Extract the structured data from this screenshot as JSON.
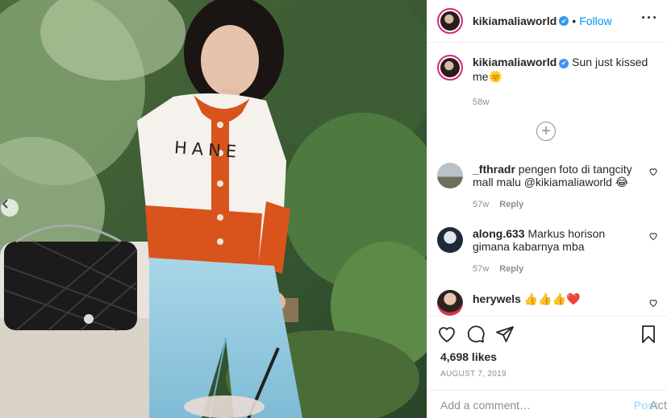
{
  "post": {
    "username": "kikiamaliaworld",
    "verified_mark": "✔",
    "separator": "•",
    "follow_label": "Follow",
    "more_label": "···",
    "caption_text": "Sun just kissed me",
    "caption_emoji": "🌞",
    "caption_time": "58w",
    "load_more_label": "+",
    "photo_sweater_text": "HANE"
  },
  "comments": [
    {
      "username": "_fthradr",
      "text": "pengen foto di tangcity mall malu @kikiamaliaworld 😂",
      "time": "57w",
      "reply_label": "Reply"
    },
    {
      "username": "along.633",
      "text": "Markus horison gimana kabarnya mba",
      "time": "57w",
      "reply_label": "Reply"
    },
    {
      "username": "herywels",
      "text": "👍👍👍❤️",
      "time": "",
      "reply_label": ""
    }
  ],
  "actions": {
    "likes_label": "4,698 likes",
    "date_label": "AUGUST 7, 2019",
    "comment_placeholder": "Add a comment…",
    "post_label": "Post",
    "watermark": "Act"
  },
  "colors": {
    "accent_blue": "#0095f6",
    "verified_blue": "#3897f0",
    "post_disabled": "#b2dffc",
    "muted": "#8e8e8e"
  },
  "icons": [
    "prev-arrow-icon",
    "verified-icon",
    "more-icon",
    "plus-circle-icon",
    "heart-icon",
    "comment-icon",
    "share-icon",
    "bookmark-icon"
  ]
}
